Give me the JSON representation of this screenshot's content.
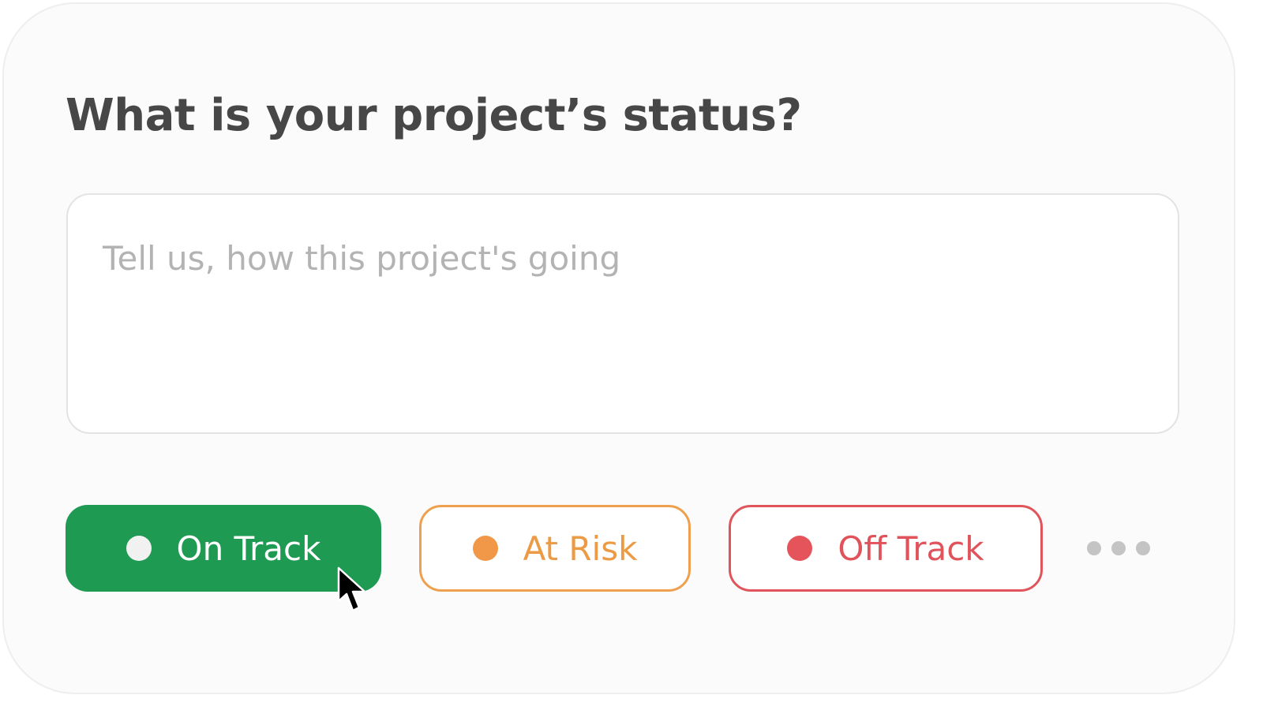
{
  "question": {
    "title": "What is your project’s status?"
  },
  "comment_field": {
    "value": "",
    "placeholder": "Tell us, how this project's going"
  },
  "status_options": [
    {
      "label": "On Track",
      "state": "selected",
      "color": "#1f9a52"
    },
    {
      "label": "At Risk",
      "state": "unselected",
      "color": "#ec9a43"
    },
    {
      "label": "Off Track",
      "state": "unselected",
      "color": "#e0535b"
    }
  ],
  "more": {
    "icon": "more-horizontal-icon"
  },
  "pointer": {
    "icon": "mouse-pointer-icon"
  }
}
